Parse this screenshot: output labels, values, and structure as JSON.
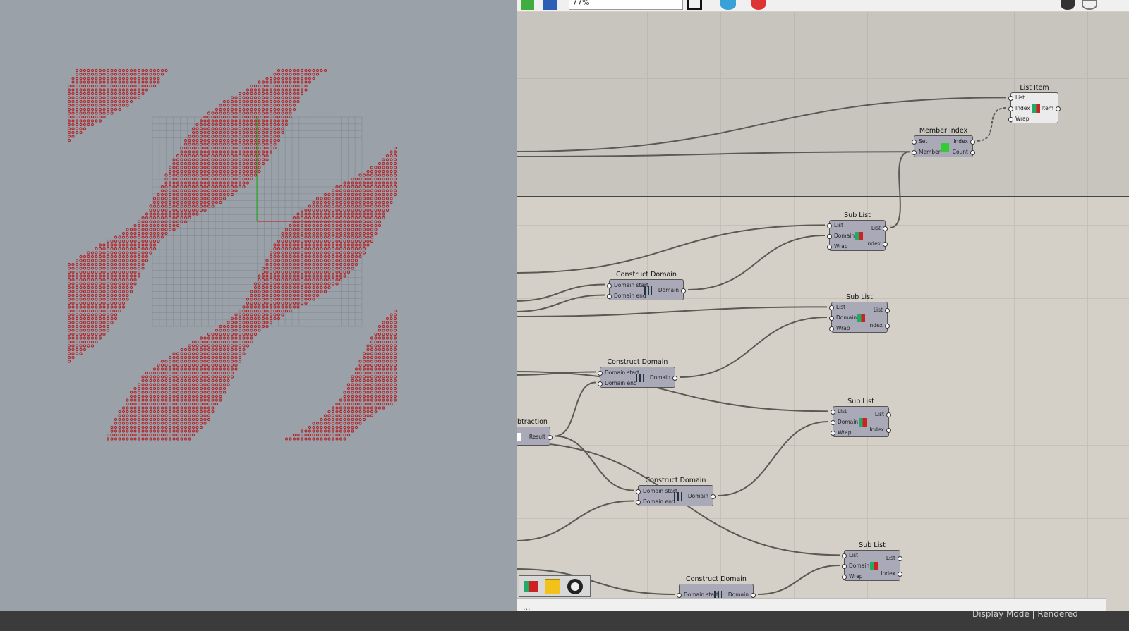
{
  "toolbar": {
    "zoom_value": "77%",
    "icons": [
      "green-document-icon",
      "save-icon",
      "zoom-extents-icon",
      "preview-eye-icon",
      "paint-icon",
      "sketch-icon",
      "settings-icon"
    ]
  },
  "viewport": {
    "background": "#9aa1a9",
    "point_color": "#b3262b",
    "grid_color": "#7f868d"
  },
  "nodes": {
    "list_item": {
      "title": "List Item",
      "inputs": [
        "List",
        "Index",
        "Wrap"
      ],
      "outputs": [
        "Item"
      ]
    },
    "member_index": {
      "title": "Member Index",
      "inputs": [
        "Set",
        "Member"
      ],
      "outputs": [
        "Index",
        "Count"
      ]
    },
    "sub_list_1": {
      "title": "Sub List",
      "inputs": [
        "List",
        "Domain",
        "Wrap"
      ],
      "outputs": [
        "List",
        "Index"
      ]
    },
    "sub_list_2": {
      "title": "Sub List",
      "inputs": [
        "List",
        "Domain",
        "Wrap"
      ],
      "outputs": [
        "List",
        "Index"
      ]
    },
    "sub_list_3": {
      "title": "Sub List",
      "inputs": [
        "List",
        "Domain",
        "Wrap"
      ],
      "outputs": [
        "List",
        "Index"
      ]
    },
    "sub_list_4": {
      "title": "Sub List",
      "inputs": [
        "List",
        "Domain",
        "Wrap"
      ],
      "outputs": [
        "List",
        "Index"
      ]
    },
    "construct_domain_1": {
      "title": "Construct Domain",
      "inputs": [
        "Domain start",
        "Domain end"
      ],
      "outputs": [
        "Domain"
      ]
    },
    "construct_domain_2": {
      "title": "Construct Domain",
      "inputs": [
        "Domain start",
        "Domain end"
      ],
      "outputs": [
        "Domain"
      ]
    },
    "construct_domain_3": {
      "title": "Construct Domain",
      "inputs": [
        "Domain start",
        "Domain end"
      ],
      "outputs": [
        "Domain"
      ]
    },
    "construct_domain_4": {
      "title": "Construct Domain",
      "inputs": [
        "Domain start"
      ],
      "outputs": [
        "Domain"
      ]
    },
    "subtraction": {
      "title": "ubtraction",
      "outputs": [
        "Result"
      ]
    }
  },
  "status": {
    "text": "..."
  },
  "bottom": {
    "display_mode": "Display Mode  |  Rendered"
  }
}
